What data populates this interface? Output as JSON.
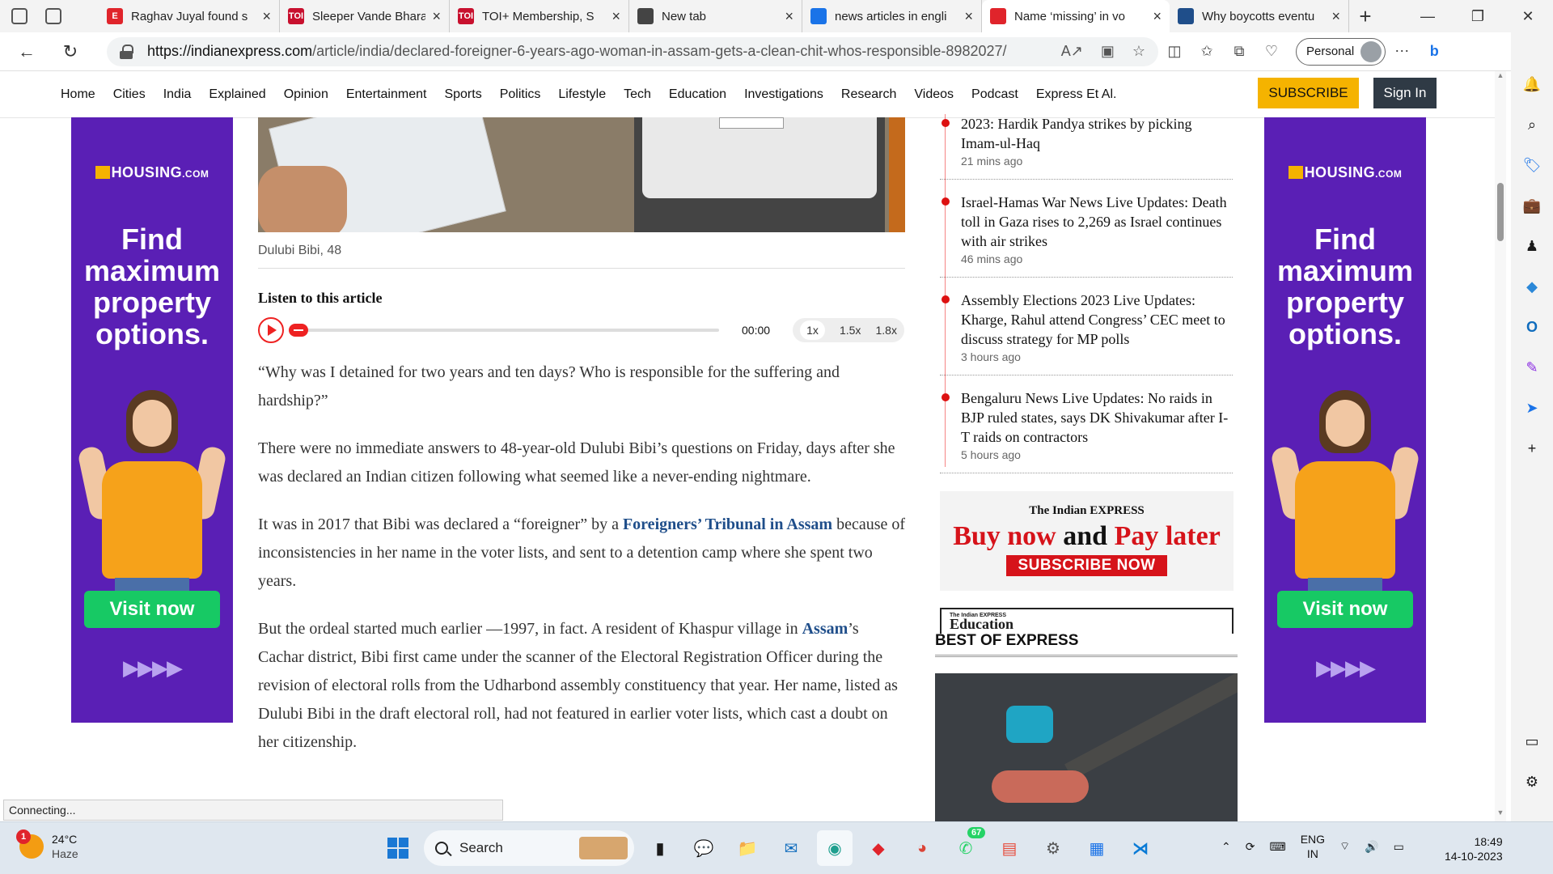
{
  "browser": {
    "tabs": [
      {
        "title": "Raghav Juyal found s",
        "fav": "E",
        "fav_color": "#e0242b",
        "active": false
      },
      {
        "title": "Sleeper Vande Bhara",
        "fav": "TOI",
        "fav_color": "#c8102e",
        "active": false
      },
      {
        "title": "TOI+ Membership, S",
        "fav": "TOI",
        "fav_color": "#c8102e",
        "active": false
      },
      {
        "title": "New tab",
        "fav": "",
        "fav_color": "#444444",
        "active": false
      },
      {
        "title": "news articles in engli",
        "fav": "",
        "fav_color": "#1a73e8",
        "active": false
      },
      {
        "title": "Name ‘missing’ in vo",
        "fav": "",
        "fav_color": "#e0242b",
        "active": true
      },
      {
        "title": "Why boycotts eventu",
        "fav": "",
        "fav_color": "#1f4e8a",
        "active": false
      }
    ],
    "url_domain": "https://indianexpress.com",
    "url_path": "/article/india/declared-foreigner-6-years-ago-woman-in-assam-gets-a-clean-chit-whos-responsible-8982027/",
    "profile_label": "Personal",
    "status_text": "Connecting..."
  },
  "site": {
    "nav": [
      "Home",
      "Cities",
      "India",
      "Explained",
      "Opinion",
      "Entertainment",
      "Sports",
      "Politics",
      "Lifestyle",
      "Tech",
      "Education",
      "Investigations",
      "Research",
      "Videos",
      "Podcast",
      "Express Et Al."
    ],
    "subscribe_label": "SUBSCRIBE",
    "signin_label": "Sign In"
  },
  "ad": {
    "brand": "HOUSING",
    "brand_suffix": ".COM",
    "headline_lines": [
      "Find",
      "maximum",
      "property",
      "options."
    ],
    "cta": "Visit now",
    "arrows": "▶▶▶▶"
  },
  "article": {
    "caption": "Dulubi Bibi, 48",
    "listen_label": "Listen to this article",
    "time": "00:00",
    "speeds": [
      "1x",
      "1.5x",
      "1.8x"
    ],
    "p1": "“Why was I detained for two years and ten days? Who is responsible for the suffering and hardship?”",
    "p2": "There were no immediate answers to 48-year-old Dulubi Bibi’s questions on Friday, days after she was declared an Indian citizen following what seemed like a never-ending nightmare.",
    "p3_a": "It was in 2017 that Bibi was declared a “foreigner” by a ",
    "p3_link": "Foreigners’ Tribunal in Assam",
    "p3_b": " because of inconsistencies in her name in the voter lists, and sent to a detention camp where she spent two years.",
    "p4_a": "But the ordeal started much earlier —1997, in fact. A resident  of Khaspur village in ",
    "p4_link": "Assam",
    "p4_b": "’s Cachar district, Bibi first came under the scanner of the Electoral Registration Officer during the revision of electoral rolls from the Udharbond assembly constituency that year. Her name, listed as Dulubi Bibi in the draft electoral roll, had not featured in earlier voter lists, which cast a doubt on her citizenship."
  },
  "live_updates": [
    {
      "title": "2023: Hardik Pandya strikes by picking Imam-ul-Haq",
      "ago": "21 mins ago"
    },
    {
      "title": "Israel-Hamas War News Live Updates: Death toll in Gaza rises to 2,269 as Israel continues with air strikes",
      "ago": "46 mins ago"
    },
    {
      "title": "Assembly Elections 2023 Live Updates: Kharge, Rahul attend Congress’ CEC meet to discuss strategy for MP polls",
      "ago": "3 hours ago"
    },
    {
      "title": "Bengaluru News Live Updates: No raids in BJP ruled states, says DK Shivakumar after I-T raids on contractors",
      "ago": "5 hours ago"
    }
  ],
  "promo": {
    "masthead": "The Indian EXPRESS",
    "line_a": "Buy now",
    "line_and": " and ",
    "line_b": "Pay later",
    "cta": "SUBSCRIBE NOW"
  },
  "edu": {
    "small": "The Indian EXPRESS",
    "name": "Education"
  },
  "best_title": "BEST OF EXPRESS",
  "taskbar": {
    "weather_badge": "1",
    "temp": "24°C",
    "condition": "Haze",
    "search_placeholder": "Search",
    "whatsapp_badge": "67",
    "lang_top": "ENG",
    "lang_bottom": "IN",
    "time": "18:49",
    "date": "14-10-2023"
  }
}
